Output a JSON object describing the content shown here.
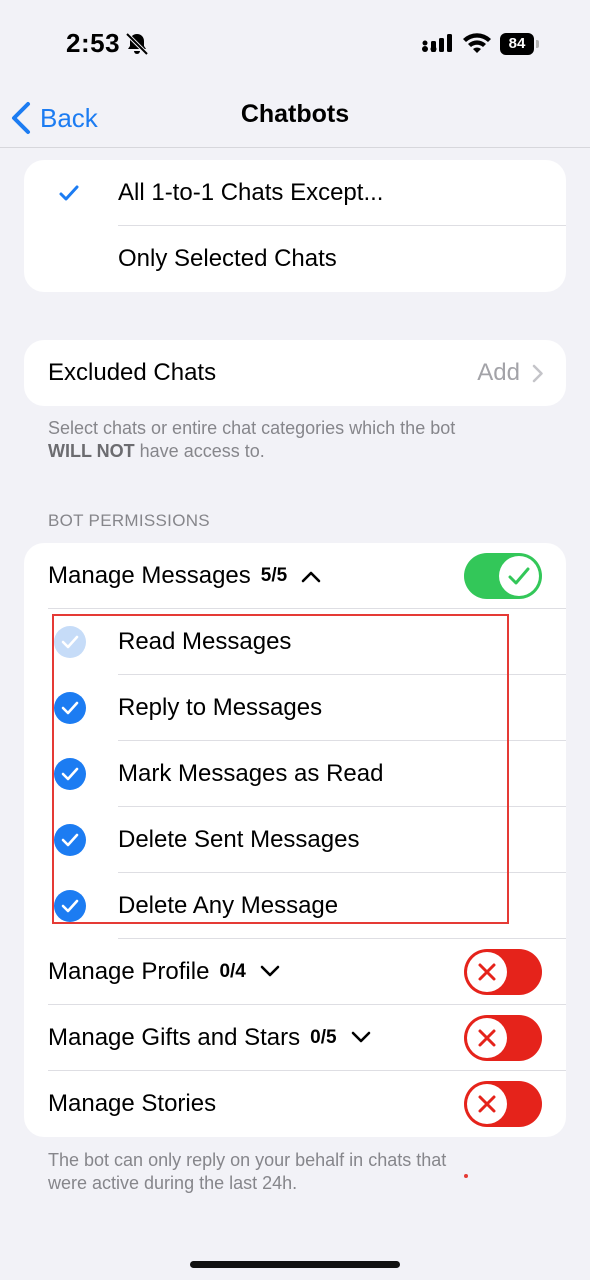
{
  "status_bar": {
    "time": "2:53",
    "battery": "84"
  },
  "nav": {
    "back_label": "Back",
    "title": "Chatbots"
  },
  "access_options": [
    {
      "label": "All 1-to-1 Chats Except...",
      "selected": true
    },
    {
      "label": "Only Selected Chats",
      "selected": false
    }
  ],
  "excluded": {
    "label": "Excluded Chats",
    "action": "Add"
  },
  "excluded_hint": {
    "line1": "Select chats or entire chat categories which the bot",
    "bold": "WILL NOT",
    "rest": " have access to."
  },
  "section_header": "BOT PERMISSIONS",
  "permissions": {
    "manage_messages": {
      "label": "Manage Messages",
      "count": "5/5",
      "enabled": true
    },
    "sub_items": [
      {
        "label": "Read Messages",
        "checked": true,
        "locked": true
      },
      {
        "label": "Reply to Messages",
        "checked": true,
        "locked": false
      },
      {
        "label": "Mark Messages as Read",
        "checked": true,
        "locked": false
      },
      {
        "label": "Delete Sent Messages",
        "checked": true,
        "locked": false
      },
      {
        "label": "Delete Any Message",
        "checked": true,
        "locked": false
      }
    ],
    "manage_profile": {
      "label": "Manage Profile",
      "count": "0/4",
      "enabled": false
    },
    "manage_gifts": {
      "label": "Manage Gifts and Stars",
      "count": "0/5",
      "enabled": false
    },
    "manage_stories": {
      "label": "Manage Stories",
      "enabled": false
    }
  },
  "footer_hint": {
    "line1": "The bot can only reply on your behalf in chats that",
    "line2": "were active during the last 24h."
  },
  "colors": {
    "accent": "#1c7cf2",
    "toggle_on": "#33c759",
    "toggle_off": "#e5231b",
    "highlight": "#e53a35"
  }
}
